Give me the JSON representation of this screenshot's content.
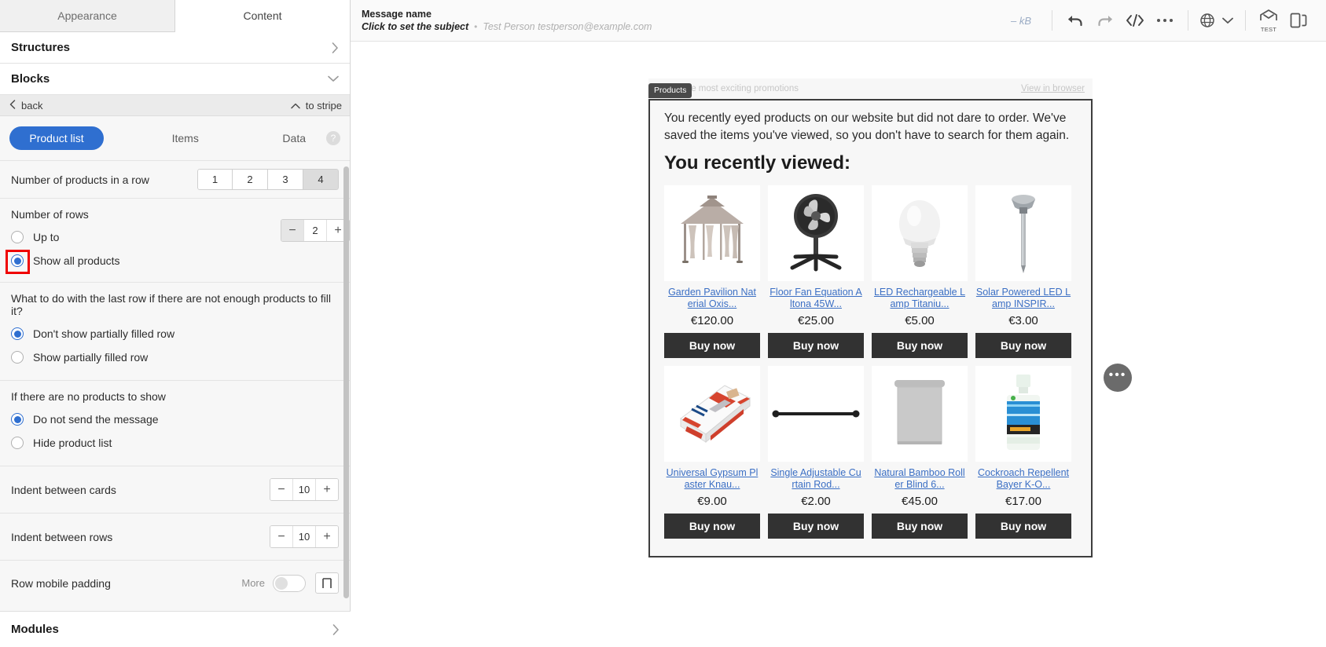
{
  "left_panel": {
    "tabs": [
      {
        "label": "Appearance",
        "active": false
      },
      {
        "label": "Content",
        "active": true
      }
    ],
    "sections": {
      "structures": "Structures",
      "blocks": "Blocks",
      "modules": "Modules"
    },
    "backbar": {
      "back": "back",
      "to_stripe": "to stripe"
    },
    "pills": [
      {
        "label": "Product list",
        "active": true
      },
      {
        "label": "Items",
        "active": false
      },
      {
        "label": "Data",
        "active": false
      }
    ],
    "help_icon": "?",
    "settings": {
      "products_in_row": {
        "label": "Number of products in a row",
        "options": [
          "1",
          "2",
          "3",
          "4"
        ],
        "selected": "4"
      },
      "number_of_rows": {
        "label": "Number of rows",
        "options": [
          {
            "label": "Up to",
            "selected": false
          },
          {
            "label": "Show all products",
            "selected": true,
            "highlighted": true
          }
        ],
        "up_to_value": "2"
      },
      "last_row": {
        "label": "What to do with the last row if there are not enough products to fill it?",
        "options": [
          {
            "label": "Don't show partially filled row",
            "selected": true
          },
          {
            "label": "Show partially filled row",
            "selected": false
          }
        ]
      },
      "no_products": {
        "label": "If there are no products to show",
        "options": [
          {
            "label": "Do not send the message",
            "selected": true
          },
          {
            "label": "Hide product list",
            "selected": false
          }
        ]
      },
      "indent_cards": {
        "label": "Indent between cards",
        "value": "10"
      },
      "indent_rows": {
        "label": "Indent between rows",
        "value": "10"
      },
      "row_mobile_padding": {
        "label": "Row mobile padding",
        "more": "More"
      }
    }
  },
  "topbar": {
    "message_name": "Message name",
    "subject_placeholder": "Click to set the subject",
    "separator": "•",
    "sender": "Test Person testperson@example.com",
    "size": "– kB",
    "icons": [
      "undo-icon",
      "redo-icon",
      "code-icon",
      "more-icon",
      "language-icon",
      "chevron-down-icon",
      "test-send-icon",
      "preview-device-icon"
    ],
    "test_label": "TEST"
  },
  "email": {
    "badge": "Products",
    "preheader": "der of the most exciting promotions",
    "view_in_browser": "View in browser",
    "intro": "You recently eyed products on our website but did not dare to order. We've saved the items you've viewed, so you don't have to search for them again.",
    "headline": "You recently viewed:",
    "buy_label": "Buy now",
    "products": [
      {
        "title": "Garden Pavilion Nat erial Oxis...",
        "price": "€120.00",
        "image": "garden-pavilion"
      },
      {
        "title": "Floor Fan Equation A ltona 45W...",
        "price": "€25.00",
        "image": "floor-fan"
      },
      {
        "title": "LED Rechargeable L amp Titaniu...",
        "price": "€5.00",
        "image": "led-bulb"
      },
      {
        "title": "Solar Powered LED Lamp INSPIR...",
        "price": "€3.00",
        "image": "solar-lamp"
      },
      {
        "title": "Universal Gypsum Pl aster Knau...",
        "price": "€9.00",
        "image": "gypsum-bag"
      },
      {
        "title": "Single Adjustable Cu rtain Rod...",
        "price": "€2.00",
        "image": "curtain-rod"
      },
      {
        "title": "Natural Bamboo Roll er Blind 6...",
        "price": "€45.00",
        "image": "roller-blind"
      },
      {
        "title": "Cockroach Repellent Bayer K-O...",
        "price": "€17.00",
        "image": "repellent-bottle"
      }
    ]
  },
  "floating_menu": {
    "icon": "ellipsis-icon"
  },
  "colors": {
    "accent": "#2f6fd0",
    "highlight": "#ef0000",
    "link": "#3b6fc4",
    "button": "#323232"
  }
}
